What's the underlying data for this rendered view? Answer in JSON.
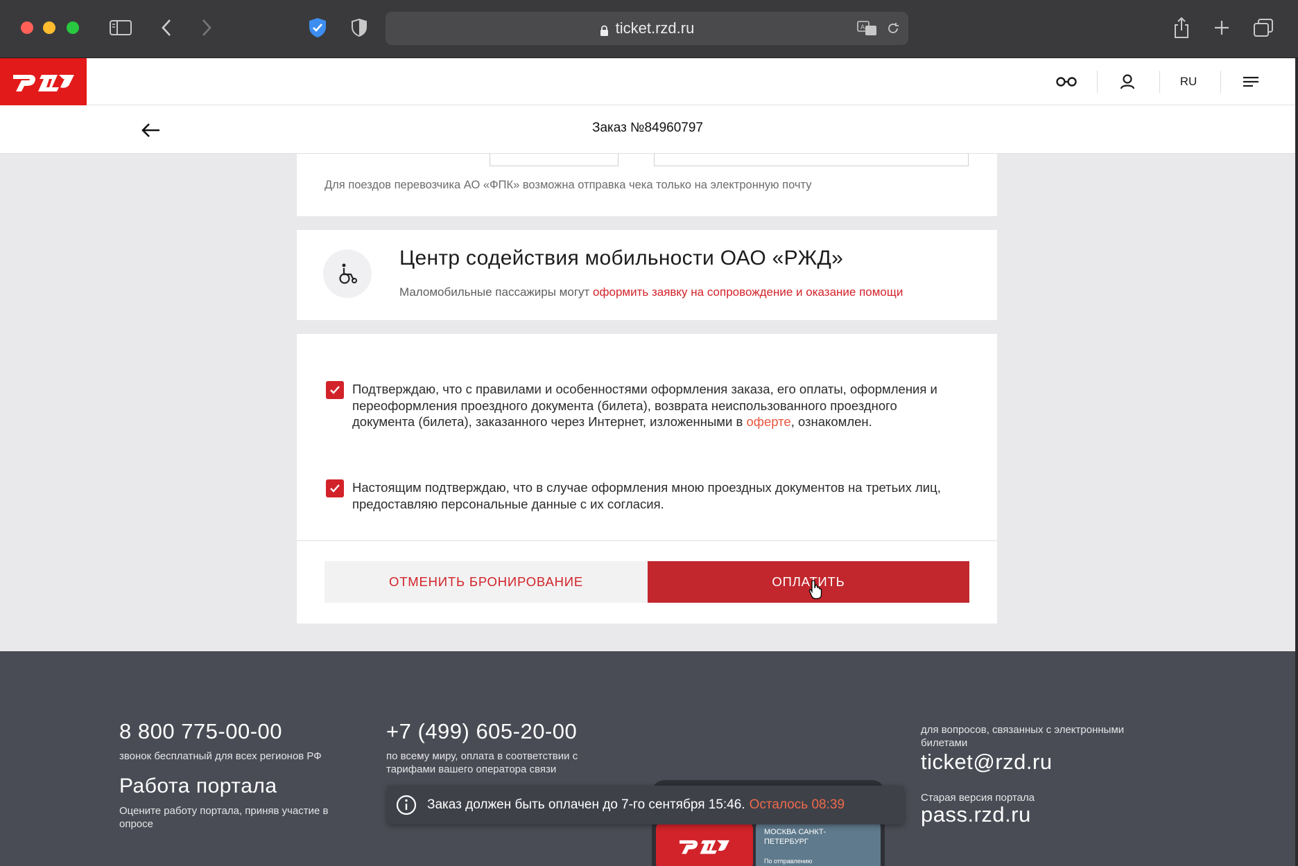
{
  "browser": {
    "url": "ticket.rzd.ru"
  },
  "header": {
    "logo_text": "РЖД",
    "lang": "RU"
  },
  "order": {
    "title": "Заказ №84960797"
  },
  "receipt": {
    "note": "Для поездов перевозчика АО «ФПК» возможна отправка чека только на электронную почту"
  },
  "mobility": {
    "title": "Центр содействия мобильности ОАО «РЖД»",
    "text": "Маломобильные пассажиры могут ",
    "link": "оформить заявку на сопровождение и оказание помощи"
  },
  "agreements": [
    {
      "text_before": "Подтверждаю, что с правилами и особенностями оформления заказа, его оплаты, оформления и переоформления проездного документа (билета), возврата неиспользованного проездного документа (билета), заказанного через Интернет, изложенными в ",
      "link": "оферте",
      "text_after": ", ознакомлен.",
      "checked": true
    },
    {
      "text_before": "Настоящим подтверждаю, что в случае оформления мною проездных документов на третьих лиц, предоставляю персональные данные с их согласия.",
      "checked": true
    }
  ],
  "actions": {
    "cancel_label": "ОТМЕНИТЬ БРОНИРОВАНИЕ",
    "pay_label": "ОПЛАТИТЬ"
  },
  "footer": {
    "phone_free": "8 800 775-00-00",
    "phone_free_note": "звонок бесплатный для всех регионов РФ",
    "phone_intl": "+7 (499) 605-20-00",
    "phone_intl_note": "по всему миру, оплата в соответствии с тарифами вашего оператора связи",
    "portal_title": "Работа портала",
    "portal_note": "Оцените работу портала, приняв участие в опросе",
    "email_note": "для вопросов, связанных с электронными билетами",
    "email": "ticket@rzd.ru",
    "old_version_note": "Старая версия портала",
    "old_version": "pass.rzd.ru",
    "phone_card_text": "МОСКВА САНКТ-ПЕТЕРБУРГ",
    "phone_card_status": "По отправлению"
  },
  "toast": {
    "message": "Заказ должен быть оплачен до 7-го сентября 15:46.",
    "timer": "Осталось 08:39"
  },
  "colors": {
    "brand_red": "#e21a1a",
    "pay_button": "#c1272d",
    "footer_bg": "#4a4c55"
  }
}
